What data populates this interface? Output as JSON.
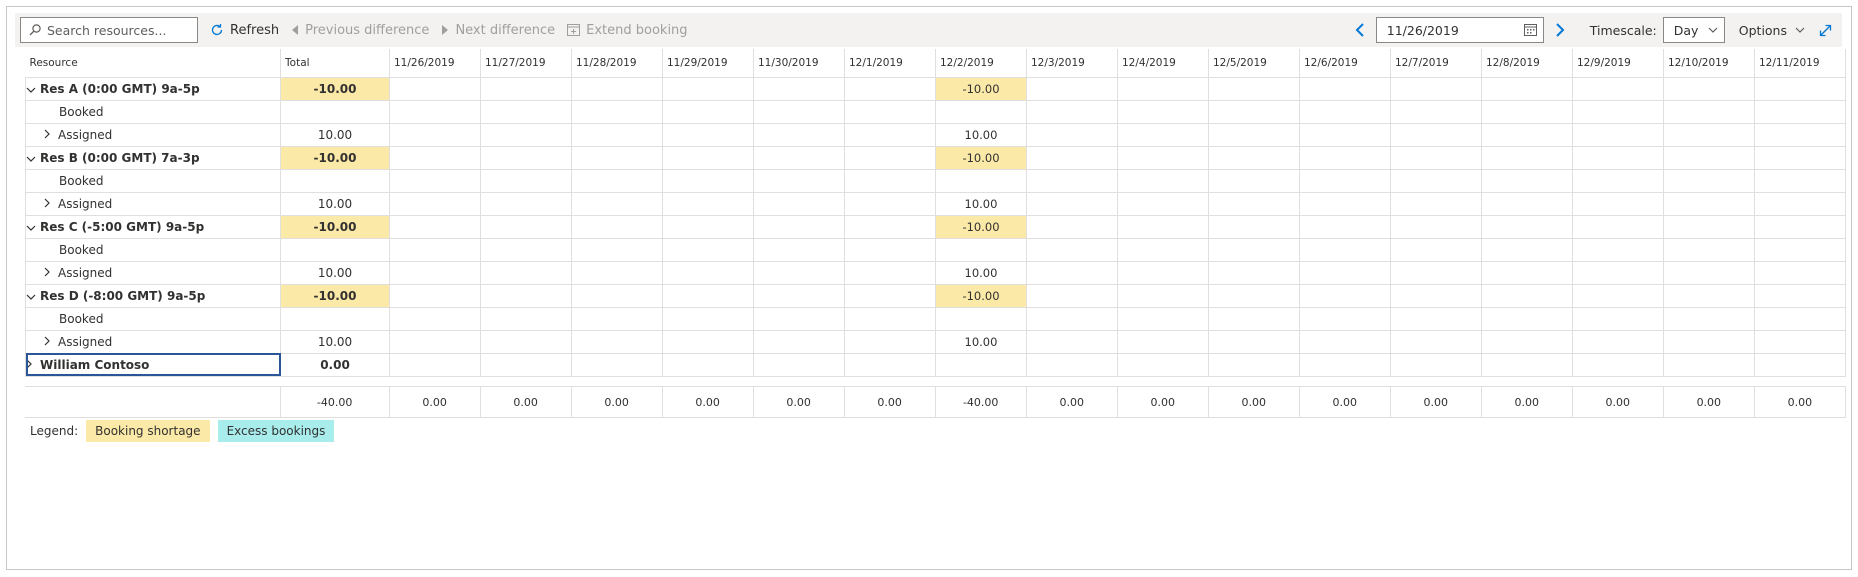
{
  "toolbar": {
    "search_placeholder": "Search resources...",
    "refresh": "Refresh",
    "previous_difference": "Previous difference",
    "next_difference": "Next difference",
    "extend_booking": "Extend booking",
    "date": "11/26/2019",
    "timescale_label": "Timescale:",
    "timescale_value": "Day",
    "options": "Options"
  },
  "grid": {
    "resource_header": "Resource",
    "total_header": "Total",
    "dates": [
      "11/26/2019",
      "11/27/2019",
      "11/28/2019",
      "11/29/2019",
      "11/30/2019",
      "12/1/2019",
      "12/2/2019",
      "12/3/2019",
      "12/4/2019",
      "12/5/2019",
      "12/6/2019",
      "12/7/2019",
      "12/8/2019",
      "12/9/2019",
      "12/10/2019",
      "12/11/2019"
    ],
    "resources": [
      {
        "name": "Res A (0:00 GMT) 9a-5p",
        "total": "-10.00",
        "cells": [
          "",
          "",
          "",
          "",
          "",
          "",
          "-10.00",
          "",
          "",
          "",
          "",
          "",
          "",
          "",
          "",
          ""
        ],
        "booked": {
          "label": "Booked",
          "total": "",
          "cells": [
            "",
            "",
            "",
            "",
            "",
            "",
            "",
            "",
            "",
            "",
            "",
            "",
            "",
            "",
            "",
            ""
          ]
        },
        "assigned": {
          "label": "Assigned",
          "total": "10.00",
          "cells": [
            "",
            "",
            "",
            "",
            "",
            "",
            "10.00",
            "",
            "",
            "",
            "",
            "",
            "",
            "",
            "",
            ""
          ]
        }
      },
      {
        "name": "Res B (0:00 GMT) 7a-3p",
        "total": "-10.00",
        "cells": [
          "",
          "",
          "",
          "",
          "",
          "",
          "-10.00",
          "",
          "",
          "",
          "",
          "",
          "",
          "",
          "",
          ""
        ],
        "booked": {
          "label": "Booked",
          "total": "",
          "cells": [
            "",
            "",
            "",
            "",
            "",
            "",
            "",
            "",
            "",
            "",
            "",
            "",
            "",
            "",
            "",
            ""
          ]
        },
        "assigned": {
          "label": "Assigned",
          "total": "10.00",
          "cells": [
            "",
            "",
            "",
            "",
            "",
            "",
            "10.00",
            "",
            "",
            "",
            "",
            "",
            "",
            "",
            "",
            ""
          ]
        }
      },
      {
        "name": "Res C (-5:00 GMT) 9a-5p",
        "total": "-10.00",
        "cells": [
          "",
          "",
          "",
          "",
          "",
          "",
          "-10.00",
          "",
          "",
          "",
          "",
          "",
          "",
          "",
          "",
          ""
        ],
        "booked": {
          "label": "Booked",
          "total": "",
          "cells": [
            "",
            "",
            "",
            "",
            "",
            "",
            "",
            "",
            "",
            "",
            "",
            "",
            "",
            "",
            "",
            ""
          ]
        },
        "assigned": {
          "label": "Assigned",
          "total": "10.00",
          "cells": [
            "",
            "",
            "",
            "",
            "",
            "",
            "10.00",
            "",
            "",
            "",
            "",
            "",
            "",
            "",
            "",
            ""
          ]
        }
      },
      {
        "name": "Res D (-8:00 GMT) 9a-5p",
        "total": "-10.00",
        "cells": [
          "",
          "",
          "",
          "",
          "",
          "",
          "-10.00",
          "",
          "",
          "",
          "",
          "",
          "",
          "",
          "",
          ""
        ],
        "booked": {
          "label": "Booked",
          "total": "",
          "cells": [
            "",
            "",
            "",
            "",
            "",
            "",
            "",
            "",
            "",
            "",
            "",
            "",
            "",
            "",
            "",
            ""
          ]
        },
        "assigned": {
          "label": "Assigned",
          "total": "10.00",
          "cells": [
            "",
            "",
            "",
            "",
            "",
            "",
            "10.00",
            "",
            "",
            "",
            "",
            "",
            "",
            "",
            "",
            ""
          ]
        }
      }
    ],
    "extra_resource": {
      "name": "William Contoso",
      "total": "0.00"
    },
    "totals": {
      "total": "-40.00",
      "cells": [
        "0.00",
        "0.00",
        "0.00",
        "0.00",
        "0.00",
        "0.00",
        "-40.00",
        "0.00",
        "0.00",
        "0.00",
        "0.00",
        "0.00",
        "0.00",
        "0.00",
        "0.00",
        "0.00"
      ]
    }
  },
  "legend": {
    "label": "Legend:",
    "booking_shortage": "Booking shortage",
    "excess_bookings": "Excess bookings"
  },
  "colors": {
    "shortage": "#fbe9a8",
    "excess": "#a8ecec",
    "accent": "#0078d4"
  }
}
